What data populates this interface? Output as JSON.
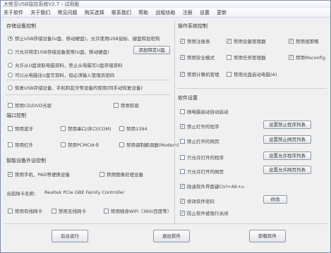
{
  "window": {
    "title": "大势至USB监控系统V2.7 - 试用版"
  },
  "menu": [
    "关于软件",
    "关于我们",
    "常见问题",
    "购买选择",
    "联系我们",
    "帮助",
    "远程协助",
    "注册",
    "设置",
    "更新"
  ],
  "storage": {
    "title": "存储设备控制",
    "options": [
      {
        "label": "禁止USB存储设备(U盘、移动硬盘)，允许使用USB鼠标、键盘和加密狗",
        "checked": true
      },
      {
        "label": "只允许特定USB存储设备使用(U盘、移动硬盘)",
        "checked": false
      },
      {
        "label": "允许从U盘读取电脑资料，禁止从电脑写U盘存储资料",
        "checked": false
      },
      {
        "label": "可以从电脑往U盘写资料，但必须输入管理员密码",
        "checked": false
      },
      {
        "label": "恢复USB存储设备、手机和蓝牙等设备的使用(同手动恢复设备)",
        "checked": false
      }
    ],
    "special_button": "添加特定U盘"
  },
  "other_devices": [
    {
      "label": "禁用CD/DVD光驱",
      "checked": false
    },
    {
      "label": "禁用软驱",
      "checked": false
    }
  ],
  "ports": {
    "title": "端口控制",
    "items": [
      {
        "label": "禁用蓝牙",
        "checked": false
      },
      {
        "label": "禁用串口/并口(COM)",
        "checked": false
      },
      {
        "label": "禁用1394",
        "checked": false
      },
      {
        "label": "禁用红外",
        "checked": false
      },
      {
        "label": "禁用PCMCIA卡",
        "checked": false
      },
      {
        "label": "禁用调制解调器(Modem)",
        "checked": false
      }
    ]
  },
  "smart": {
    "title": "智能设备外设控制",
    "items": [
      {
        "label": "禁用手机、PAD等便携设备",
        "checked": true
      },
      {
        "label": "禁用图像处理设备",
        "checked": false
      }
    ]
  },
  "network": {
    "title": "当前网卡名称：",
    "value": "Realtek PCIe GBE Family Controller",
    "items": [
      {
        "label": "禁用有线网卡",
        "checked": false
      },
      {
        "label": "禁用无线网卡",
        "checked": false
      },
      {
        "label": "禁用随身WiFi（360/百度等）",
        "checked": false
      }
    ]
  },
  "os": {
    "title": "操作系统控制",
    "items": [
      {
        "label": "禁用注册表",
        "checked": true
      },
      {
        "label": "禁用设备管理器",
        "checked": true
      },
      {
        "label": "禁用组策略",
        "checked": true
      },
      {
        "label": "禁用安全模式",
        "checked": true
      },
      {
        "label": "禁用任务管理器",
        "checked": false
      },
      {
        "label": "禁用Msconfig",
        "checked": true
      },
      {
        "label": "禁用计算机管理",
        "checked": true
      },
      {
        "label": "禁用光盘启动电脑(A)",
        "checked": false
      }
    ]
  },
  "software": {
    "title": "软件设置",
    "items": [
      {
        "label": "随电脑启动自动启动",
        "checked": false
      },
      {
        "label": "禁止打开的程序",
        "checked": true
      },
      {
        "label": "禁止打开的网页",
        "checked": false
      },
      {
        "label": "只允许打开的程序",
        "checked": false
      },
      {
        "label": "只允许打开的网页",
        "checked": false
      },
      {
        "label": "隐退软件界面键Ctrl+Alt+u",
        "checked": true
      },
      {
        "label": "修改软件密码",
        "checked": true
      },
      {
        "label": "防止软件被强行关闭",
        "checked": true
      }
    ],
    "buttons": [
      "设置禁止程序列表",
      "设置禁止网页列表",
      "设置允许程序列表",
      "设置允许网页列表",
      "修改"
    ]
  },
  "footer": {
    "buttons": [
      "后台运行",
      "退出软件",
      "卸载软件"
    ]
  }
}
